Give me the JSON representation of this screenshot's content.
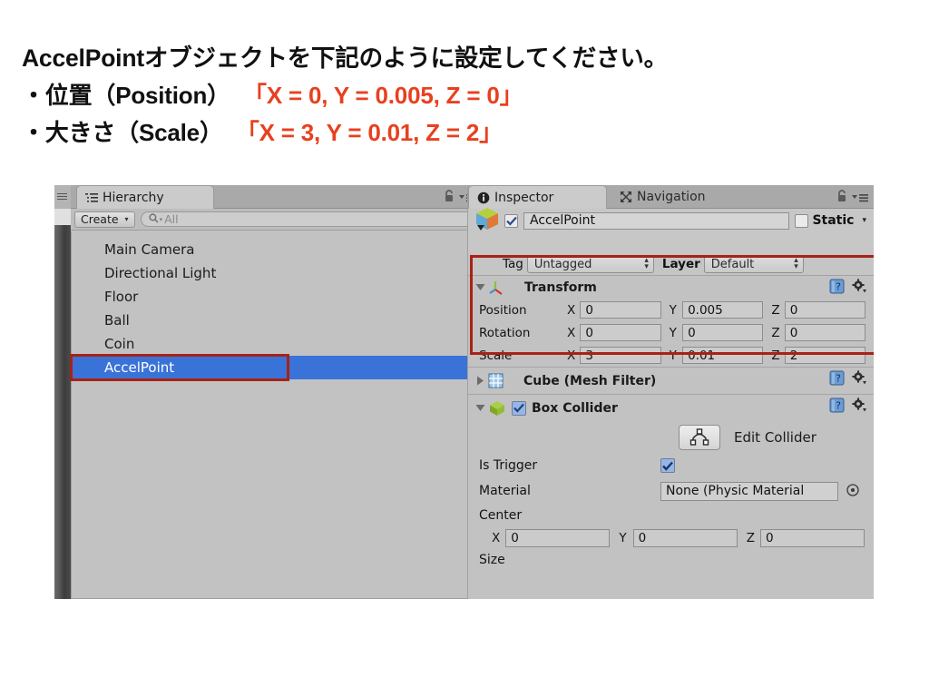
{
  "instructions": {
    "line1": "AccelPointオブジェクトを下記のように設定してください。",
    "line2_bullet": "・位置（Position）",
    "line2_value": "「X = 0, Y = 0.005, Z = 0」",
    "line3_bullet": "・大きさ（Scale）",
    "line3_value": "「X = 3, Y = 0.01, Z = 2」",
    "accent_color": "#e8401f"
  },
  "hierarchy": {
    "tab_label": "Hierarchy",
    "create_button": "Create",
    "create_caret": "▾",
    "search_placeholder": "All",
    "items": [
      {
        "label": "Main Camera",
        "selected": false
      },
      {
        "label": "Directional Light",
        "selected": false
      },
      {
        "label": "Floor",
        "selected": false
      },
      {
        "label": "Ball",
        "selected": false
      },
      {
        "label": "Coin",
        "selected": false
      },
      {
        "label": "AccelPoint",
        "selected": true
      }
    ],
    "selection_color": "#3a73d8",
    "highlight_color": "#a82216"
  },
  "inspector": {
    "tabs": [
      {
        "label": "Inspector",
        "active": true
      },
      {
        "label": "Navigation",
        "active": false
      }
    ],
    "object": {
      "enabled_checkbox": "✔",
      "name": "AccelPoint",
      "static_label": "Static",
      "static_checked": false,
      "static_caret": "▾"
    },
    "tag": {
      "label": "Tag",
      "value": "Untagged"
    },
    "layer": {
      "label": "Layer",
      "value": "Default"
    },
    "components": [
      {
        "id": "transform",
        "title": "Transform",
        "expanded": true,
        "highlighted": true,
        "rows": [
          {
            "label": "Position",
            "x": "0",
            "y": "0.005",
            "z": "0"
          },
          {
            "label": "Rotation",
            "x": "0",
            "y": "0",
            "z": "0"
          },
          {
            "label": "Scale",
            "x": "3",
            "y": "0.01",
            "z": "2"
          }
        ]
      },
      {
        "id": "mesh-filter",
        "title": "Cube (Mesh Filter)",
        "expanded": false
      },
      {
        "id": "box-collider",
        "title": "Box Collider",
        "expanded": true,
        "enabled_checkbox": "✔",
        "edit_collider_label": "Edit Collider",
        "is_trigger": {
          "label": "Is Trigger",
          "checked": true,
          "mark": "✔"
        },
        "material": {
          "label": "Material",
          "value": "None (Physic Material"
        },
        "center": {
          "label": "Center",
          "x": "0",
          "y": "0",
          "z": "0"
        },
        "size": {
          "label": "Size"
        }
      }
    ],
    "axis_labels": {
      "x": "X",
      "y": "Y",
      "z": "Z"
    }
  },
  "colors": {
    "panel_bg": "#c2c2c2",
    "tabbar_bg": "#a9a9a9",
    "field_bg": "#cccccc",
    "selection_blue": "#3a73d8",
    "highlight_red": "#a82216"
  }
}
